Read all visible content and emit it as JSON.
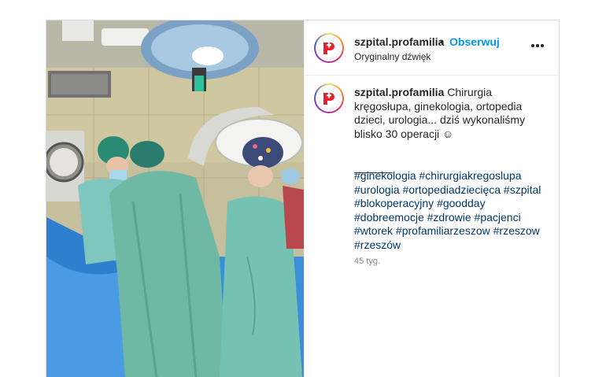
{
  "post": {
    "username": "szpital.profamilia",
    "separator": "•",
    "follow_label": "Obserwuj",
    "audio": "Oryginalny dźwięk",
    "more_label": "więcej opcji"
  },
  "caption": {
    "username": "szpital.profamilia",
    "text": "Chirurgia kręgosłupa, ginekologia, ortopedia dzieci, urologia... dziś wykonaliśmy blisko 30 operacji ☺",
    "divider": "_______",
    "hashtags": [
      "#ginekologia",
      "#chirurgiakregoslupa",
      "#urologia",
      "#ortopediadziecięca",
      "#szpital",
      "#blokoperacyjny",
      "#goodday",
      "#dobreemocje",
      "#zdrowie",
      "#pacjenci",
      "#wtorek",
      "#profamiliarzeszow",
      "#rzeszow",
      "#rzeszów"
    ],
    "time": "45 tyg."
  },
  "colors": {
    "accent": "#0095f6",
    "hashtag": "#00376b",
    "brand_red": "#e8212f",
    "text": "#262626",
    "muted": "#8e8e8e"
  },
  "icons": {
    "logo": "profamilia-logo-icon",
    "more": "more-options-icon"
  }
}
